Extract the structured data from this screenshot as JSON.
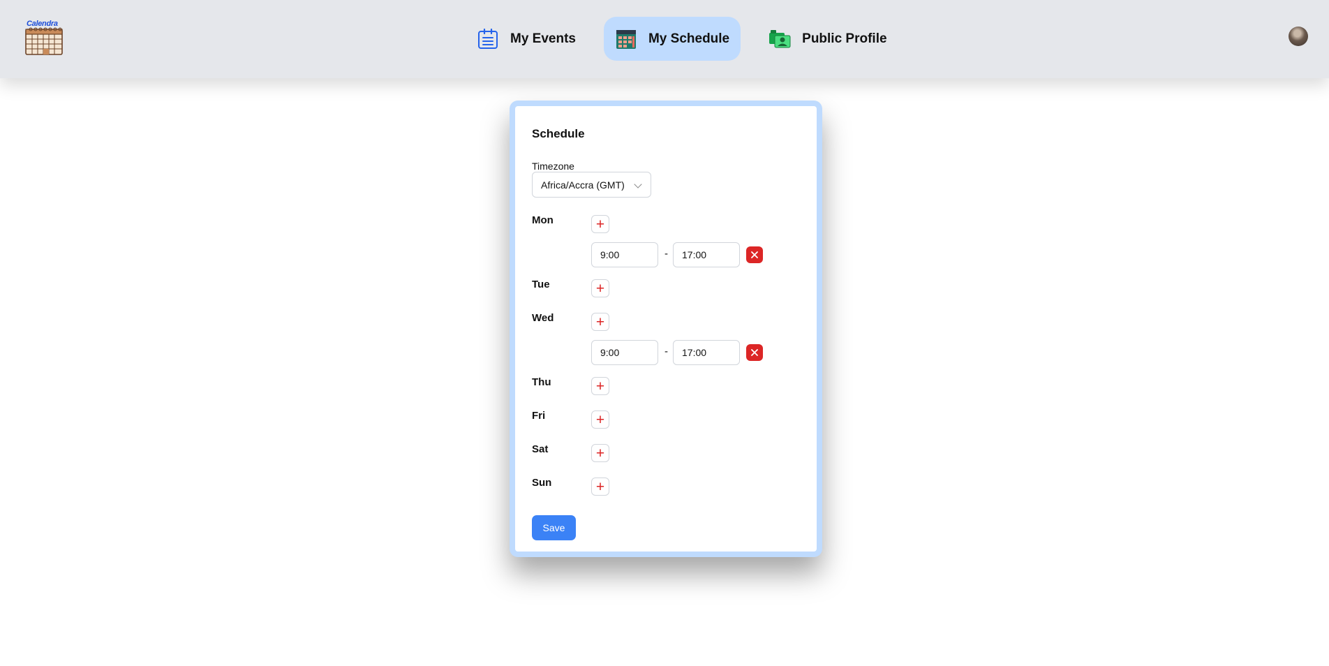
{
  "app": {
    "logo_text": "Calendra"
  },
  "nav": {
    "items": [
      {
        "label": "My Events",
        "icon": "clipboard-list-icon"
      },
      {
        "label": "My Schedule",
        "icon": "calendar-grid-icon",
        "active": true
      },
      {
        "label": "Public Profile",
        "icon": "profile-id-card-icon"
      }
    ]
  },
  "schedule": {
    "title": "Schedule",
    "timezone_label": "Timezone",
    "timezone_value": "Africa/Accra (GMT)",
    "days": [
      {
        "name": "Mon",
        "slots": [
          {
            "start": "9:00",
            "end": "17:00"
          }
        ]
      },
      {
        "name": "Tue",
        "slots": []
      },
      {
        "name": "Wed",
        "slots": [
          {
            "start": "9:00",
            "end": "17:00"
          }
        ]
      },
      {
        "name": "Thu",
        "slots": []
      },
      {
        "name": "Fri",
        "slots": []
      },
      {
        "name": "Sat",
        "slots": []
      },
      {
        "name": "Sun",
        "slots": []
      }
    ],
    "add_symbol": "+",
    "separator": "-",
    "save_label": "Save"
  },
  "colors": {
    "accent": "#3b82f6",
    "nav_active": "#bfdbfe",
    "danger": "#dc2626",
    "header_bg": "#e5e7eb"
  }
}
